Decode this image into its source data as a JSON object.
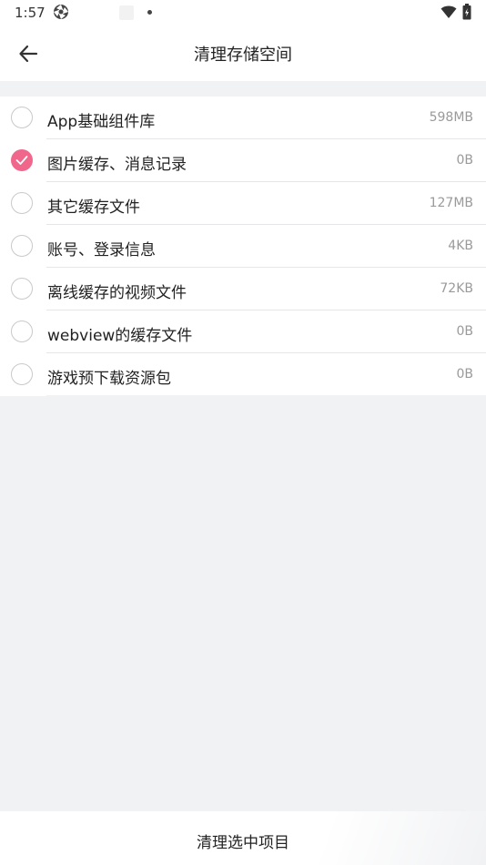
{
  "status_bar": {
    "time": "1:57"
  },
  "header": {
    "title": "清理存储空间"
  },
  "items": [
    {
      "label": "App基础组件库",
      "size": "598MB",
      "checked": false
    },
    {
      "label": "图片缓存、消息记录",
      "size": "0B",
      "checked": true
    },
    {
      "label": "其它缓存文件",
      "size": "127MB",
      "checked": false
    },
    {
      "label": "账号、登录信息",
      "size": "4KB",
      "checked": false
    },
    {
      "label": "离线缓存的视频文件",
      "size": "72KB",
      "checked": false
    },
    {
      "label": "webview的缓存文件",
      "size": "0B",
      "checked": false
    },
    {
      "label": "游戏预下载资源包",
      "size": "0B",
      "checked": false
    }
  ],
  "footer": {
    "action_label": "清理选中项目"
  },
  "colors": {
    "accent": "#f0678b",
    "background": "#f1f2f4"
  },
  "icons": {
    "back": "arrow-left-icon",
    "check": "check-icon",
    "wifi": "wifi-icon",
    "battery": "battery-icon",
    "app": "aperture-icon"
  }
}
